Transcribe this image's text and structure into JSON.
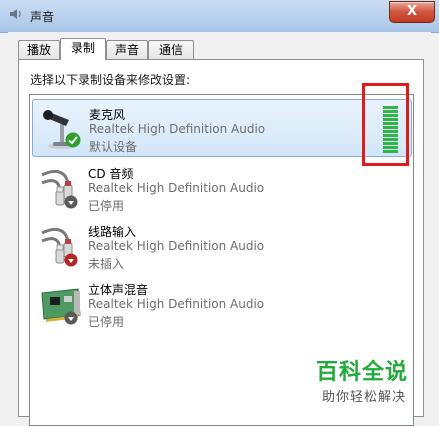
{
  "window": {
    "title": "声音",
    "close_label": "X"
  },
  "tabs": [
    {
      "label": "播放",
      "active": false
    },
    {
      "label": "录制",
      "active": true
    },
    {
      "label": "声音",
      "active": false
    },
    {
      "label": "通信",
      "active": false
    }
  ],
  "prompt": "选择以下录制设备来修改设置:",
  "devices": [
    {
      "name": "麦克风",
      "description": "Realtek High Definition Audio",
      "status": "默认设备",
      "icon": "microphone-icon",
      "badge": "default-check",
      "selected": true,
      "level_bars": 12
    },
    {
      "name": "CD 音频",
      "description": "Realtek High Definition Audio",
      "status": "已停用",
      "icon": "rca-cable-icon",
      "badge": "disabled-arrow",
      "selected": false
    },
    {
      "name": "线路输入",
      "description": "Realtek High Definition Audio",
      "status": "未插入",
      "icon": "rca-cable-icon",
      "badge": "unplugged-arrow",
      "selected": false
    },
    {
      "name": "立体声混音",
      "description": "Realtek High Definition Audio",
      "status": "已停用",
      "icon": "sound-card-icon",
      "badge": "disabled-arrow",
      "selected": false
    }
  ],
  "colors": {
    "level_meter": "#34b34a",
    "highlight_box": "#e01b1b",
    "watermark": "#23aa3c"
  },
  "watermark": {
    "logo": "百科全说",
    "subtitle": "助你轻松解决"
  }
}
